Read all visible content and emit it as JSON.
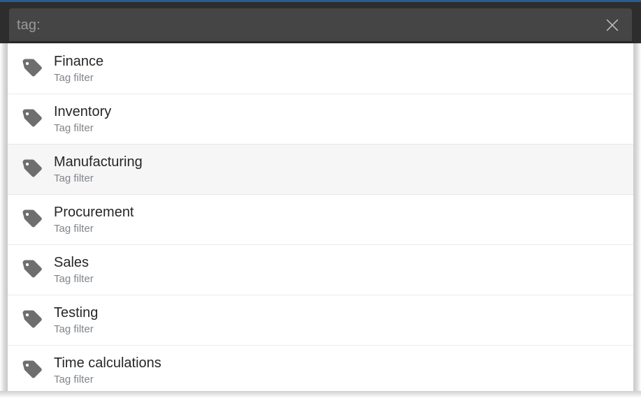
{
  "theme": {
    "accent_line_color": "#2a5d8f",
    "search_chrome_color": "#2d2d2d",
    "search_field_color": "#454545",
    "search_text_color": "#9a9a9a",
    "panel_background": "#ffffff",
    "selected_row_color": "#f6f6f6",
    "title_color": "#262626",
    "subtitle_color": "#80858a",
    "tag_icon_color": "#6e6e6e"
  },
  "search": {
    "value": "tag:",
    "placeholder": "tag:",
    "clear_icon": "close-icon",
    "clear_label": "Clear search"
  },
  "results": {
    "row_icon": "tag-icon",
    "items": [
      {
        "title": "Finance",
        "subtitle": "Tag filter",
        "selected": false
      },
      {
        "title": "Inventory",
        "subtitle": "Tag filter",
        "selected": false
      },
      {
        "title": "Manufacturing",
        "subtitle": "Tag filter",
        "selected": true
      },
      {
        "title": "Procurement",
        "subtitle": "Tag filter",
        "selected": false
      },
      {
        "title": "Sales",
        "subtitle": "Tag filter",
        "selected": false
      },
      {
        "title": "Testing",
        "subtitle": "Tag filter",
        "selected": false
      },
      {
        "title": "Time calculations",
        "subtitle": "Tag filter",
        "selected": false
      }
    ]
  }
}
